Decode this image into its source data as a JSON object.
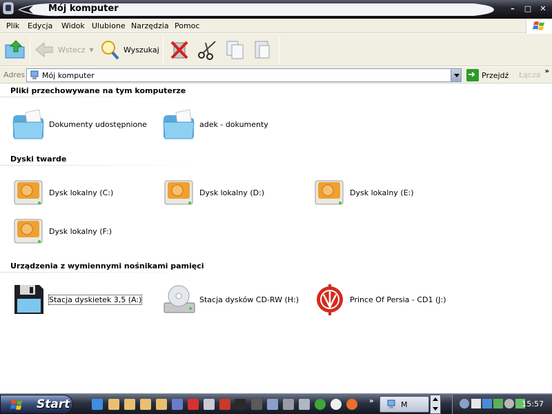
{
  "window": {
    "title": "Mój komputer",
    "controls": {
      "minimize": "–",
      "maximize": "□",
      "close": "✕"
    }
  },
  "menu": [
    "Plik",
    "Edycja",
    "Widok",
    "Ulubione",
    "Narzędzia",
    "Pomoc"
  ],
  "toolbar": {
    "back_label": "Wstecz",
    "search_label": "Wyszukaj"
  },
  "address": {
    "label": "Adres",
    "value": "Mój komputer",
    "go_label": "Przejdź",
    "links_label": "Łącza"
  },
  "sections": [
    {
      "title": "Pliki przechowywane na tym komputerze",
      "items": [
        {
          "label": "Dokumenty udostępnione",
          "icon": "shared-folder-icon"
        },
        {
          "label": "adek - dokumenty",
          "icon": "folder-icon"
        }
      ]
    },
    {
      "title": "Dyski twarde",
      "items": [
        {
          "label": "Dysk lokalny (C:)",
          "icon": "hard-drive-icon"
        },
        {
          "label": "Dysk lokalny (D:)",
          "icon": "hard-drive-icon"
        },
        {
          "label": "Dysk lokalny (E:)",
          "icon": "hard-drive-icon"
        },
        {
          "label": "Dysk lokalny (F:)",
          "icon": "hard-drive-icon"
        }
      ]
    },
    {
      "title": "Urządzenia z wymiennymi nośnikami pamięci",
      "items": [
        {
          "label": "Stacja dyskietek 3,5 (A:)",
          "icon": "floppy-drive-icon"
        },
        {
          "label": "Stacja dysków CD-RW (H:)",
          "icon": "cd-drive-icon"
        },
        {
          "label": "Prince Of Persia - CD1 (J:)",
          "icon": "prince-of-persia-cd-icon"
        }
      ]
    }
  ],
  "taskbar": {
    "start_label": "Start",
    "task_label": "M",
    "clock": "15:57"
  },
  "colors": {
    "window_bg": "#ffffff",
    "bar_bg": "#f1efe2",
    "titlebar_dark": "#0e0f13",
    "drive_amber": "#f0a030",
    "folder_blue": "#6fb7e8"
  }
}
